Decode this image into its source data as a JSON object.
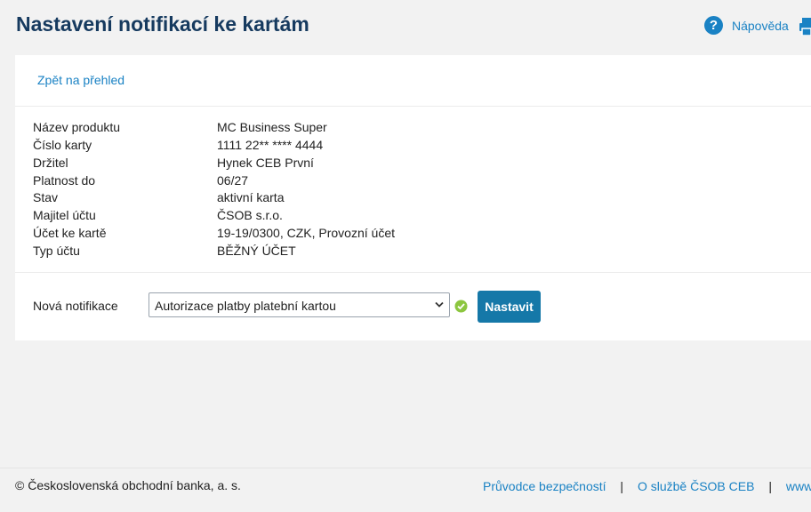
{
  "header": {
    "title": "Nastavení notifikací ke kartám",
    "help_label": "Nápověda"
  },
  "nav": {
    "back_label": "Zpět na přehled"
  },
  "details": [
    {
      "label": "Název produktu",
      "value": "MC Business Super"
    },
    {
      "label": "Číslo karty",
      "value": "1111 22** **** 4444"
    },
    {
      "label": "Držitel",
      "value": "Hynek CEB První"
    },
    {
      "label": "Platnost do",
      "value": "06/27"
    },
    {
      "label": "Stav",
      "value": "aktivní karta"
    },
    {
      "label": "Majitel účtu",
      "value": "ČSOB s.r.o."
    },
    {
      "label": "Účet ke kartě",
      "value": "19-19/0300, CZK, Provozní účet"
    },
    {
      "label": "Typ účtu",
      "value": "BĚŽNÝ ÚČET"
    }
  ],
  "notification": {
    "label": "Nová notifikace",
    "selected": "Autorizace platby platební kartou",
    "button_label": "Nastavit"
  },
  "footer": {
    "copyright": "© Československá obchodní banka, a. s.",
    "links": [
      "Průvodce bezpečností",
      "O službě ČSOB CEB",
      "www.cs"
    ],
    "separator": "|"
  },
  "colors": {
    "accent": "#1a82c4",
    "button": "#1578a8",
    "title": "#163a5f",
    "check": "#8cc63f"
  },
  "icons": {
    "help": "question-circle-icon",
    "print": "printer-icon",
    "select": "chevron-down-icon",
    "status": "check-circle-icon"
  }
}
